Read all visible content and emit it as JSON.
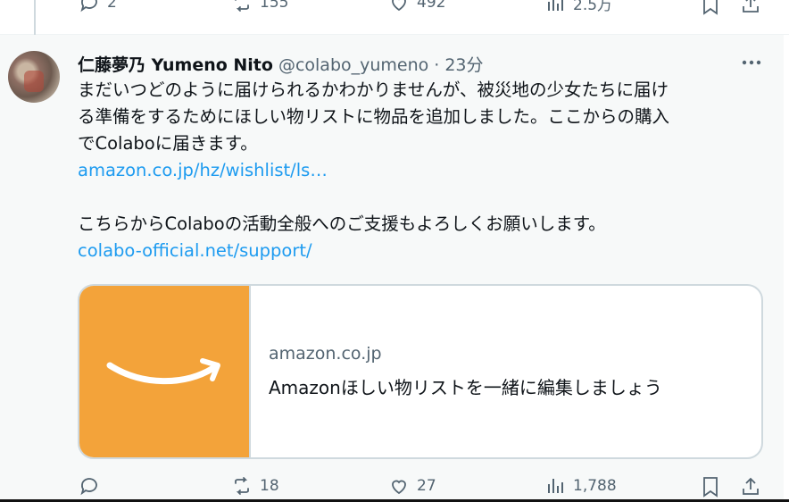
{
  "previous_tweet": {
    "reply_count": "2",
    "retweet_count": "155",
    "like_count": "492",
    "view_count": "2.5万"
  },
  "tweet": {
    "author_name": "仁藤夢乃 Yumeno Nito",
    "handle": "@colabo_yumeno",
    "separator": "·",
    "time": "23分",
    "text_lines": [
      "まだいつどのように届けられるかわかりませんが、被災地の少女たちに届け",
      "る準備をするためにほしい物リストに物品を追加しました。ここからの購入",
      "でColaboに届きます。"
    ],
    "link1": "amazon.co.jp/hz/wishlist/ls…",
    "text2": "こちらからColaboの活動全般へのご支援もよろしくお願いします。",
    "link2": "colabo-official.net/support/",
    "card": {
      "domain": "amazon.co.jp",
      "title": "Amazonほしい物リストを一緒に編集しましょう",
      "image_color": "#f3a33a"
    },
    "reply_count": "",
    "retweet_count": "18",
    "like_count": "27",
    "view_count": "1,788"
  },
  "icons": [
    "reply-icon",
    "retweet-icon",
    "like-icon",
    "views-icon",
    "bookmark-icon",
    "share-icon",
    "more-icon"
  ],
  "colors": {
    "link": "#1d9bf0",
    "secondary_text": "#536471",
    "tweet_background": "#f7f9f9"
  }
}
